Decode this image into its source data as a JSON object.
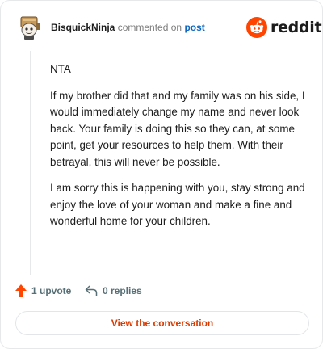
{
  "header": {
    "username": "BisquickNinja",
    "action_text": "commented on",
    "post_link": "post",
    "brand_wordmark": "reddit",
    "avatar_icon": "snoo-avatar-icon",
    "brand_icon": "reddit-logo-icon"
  },
  "comment": {
    "paragraphs": [
      "NTA",
      "If my brother did that and my family was on his side, I would immediately change my name and never look back. Your family is doing this so they can, at some point, get your resources to help them. With their betrayal, this will never be possible.",
      "I am sorry this is happening with you, stay strong and enjoy the love of your woman and make a fine and wonderful home for your children."
    ]
  },
  "actions": {
    "upvote_label": "1 upvote",
    "reply_label": "0 replies",
    "upvote_icon": "upvote-arrow-icon",
    "reply_icon": "reply-icon"
  },
  "cta": {
    "label": "View the conversation"
  },
  "colors": {
    "accent": "#d93a00",
    "upvote": "#ff4500",
    "link": "#0a66c2",
    "muted": "#7c7c7c"
  }
}
